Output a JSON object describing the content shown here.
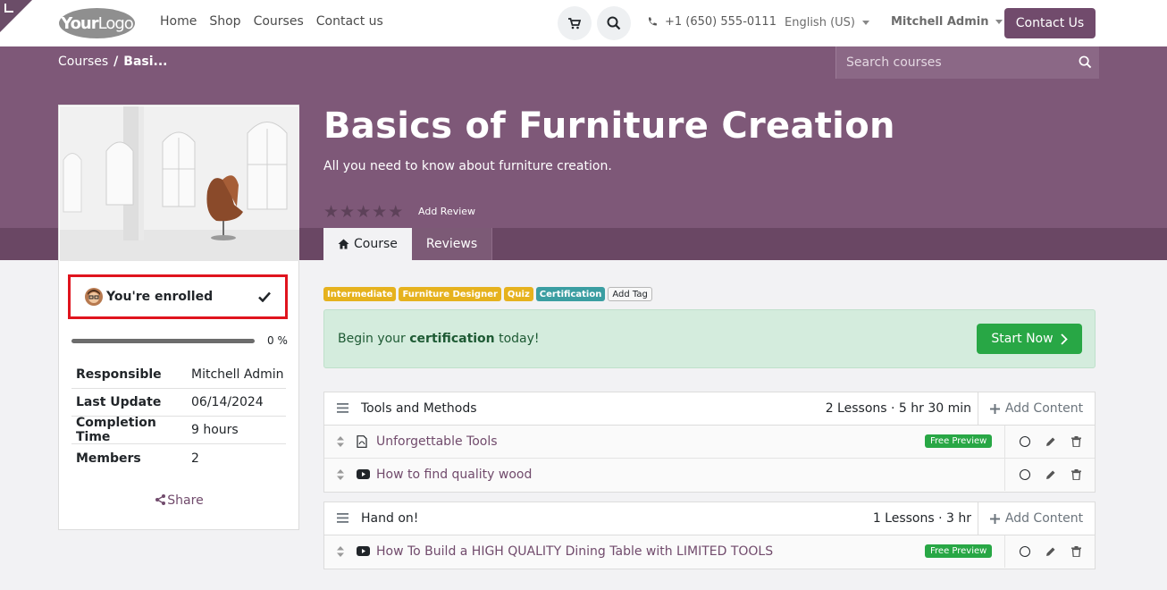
{
  "header": {
    "logo_text_bold": "Your",
    "logo_text": "Logo",
    "nav": [
      "Home",
      "Shop",
      "Courses",
      "Contact us"
    ],
    "phone": "+1 (650) 555-0111",
    "language": "English (US)",
    "user": "Mitchell Admin",
    "contact_button": "Contact Us"
  },
  "breadcrumb": {
    "root": "Courses",
    "sep": "/",
    "current": "Basi..."
  },
  "search": {
    "placeholder": "Search courses"
  },
  "course": {
    "title": "Basics of Furniture Creation",
    "subtitle": "All you need to know about furniture creation.",
    "rating_stars": 5,
    "rating_filled": 0,
    "add_review": "Add Review"
  },
  "tabs": [
    {
      "label": "Course",
      "active": true
    },
    {
      "label": "Reviews",
      "active": false
    }
  ],
  "sidebar": {
    "enrolled_label": "You're enrolled",
    "progress_percent": 0,
    "progress_label": "0 %",
    "info": [
      {
        "key": "Responsible",
        "value": "Mitchell Admin"
      },
      {
        "key": "Last Update",
        "value": "06/14/2024"
      },
      {
        "key": "Completion Time",
        "value": "9 hours"
      },
      {
        "key": "Members",
        "value": "2"
      }
    ],
    "share_label": "Share"
  },
  "tags": [
    {
      "label": "Intermediate",
      "color": "#e6b21e"
    },
    {
      "label": "Furniture Designer",
      "color": "#e6b21e"
    },
    {
      "label": "Quiz",
      "color": "#e6b21e"
    },
    {
      "label": "Certification",
      "color": "#3b9ea2"
    }
  ],
  "add_tag_label": "Add Tag",
  "certification": {
    "text_before": "Begin your ",
    "text_bold": "certification",
    "text_after": " today!",
    "button": "Start Now"
  },
  "sections": [
    {
      "title": "Tools and Methods",
      "meta": "2 Lessons · 5 hr 30 min",
      "add_content": "Add Content",
      "lessons": [
        {
          "title": "Unforgettable Tools",
          "type": "pdf",
          "free_preview": "Free Preview"
        },
        {
          "title": "How to find quality wood",
          "type": "video",
          "free_preview": ""
        }
      ]
    },
    {
      "title": "Hand on!",
      "meta": "1 Lessons · 3 hr",
      "add_content": "Add Content",
      "lessons": [
        {
          "title": "How To Build a HIGH QUALITY Dining Table with LIMITED TOOLS",
          "type": "video",
          "free_preview": "Free Preview"
        }
      ]
    }
  ],
  "colors": {
    "brand": "#714b6c",
    "hero": "#7e5878",
    "success": "#28a745",
    "warning": "#e6b21e",
    "info": "#3b9ea2",
    "highlight": "#e0141e"
  }
}
